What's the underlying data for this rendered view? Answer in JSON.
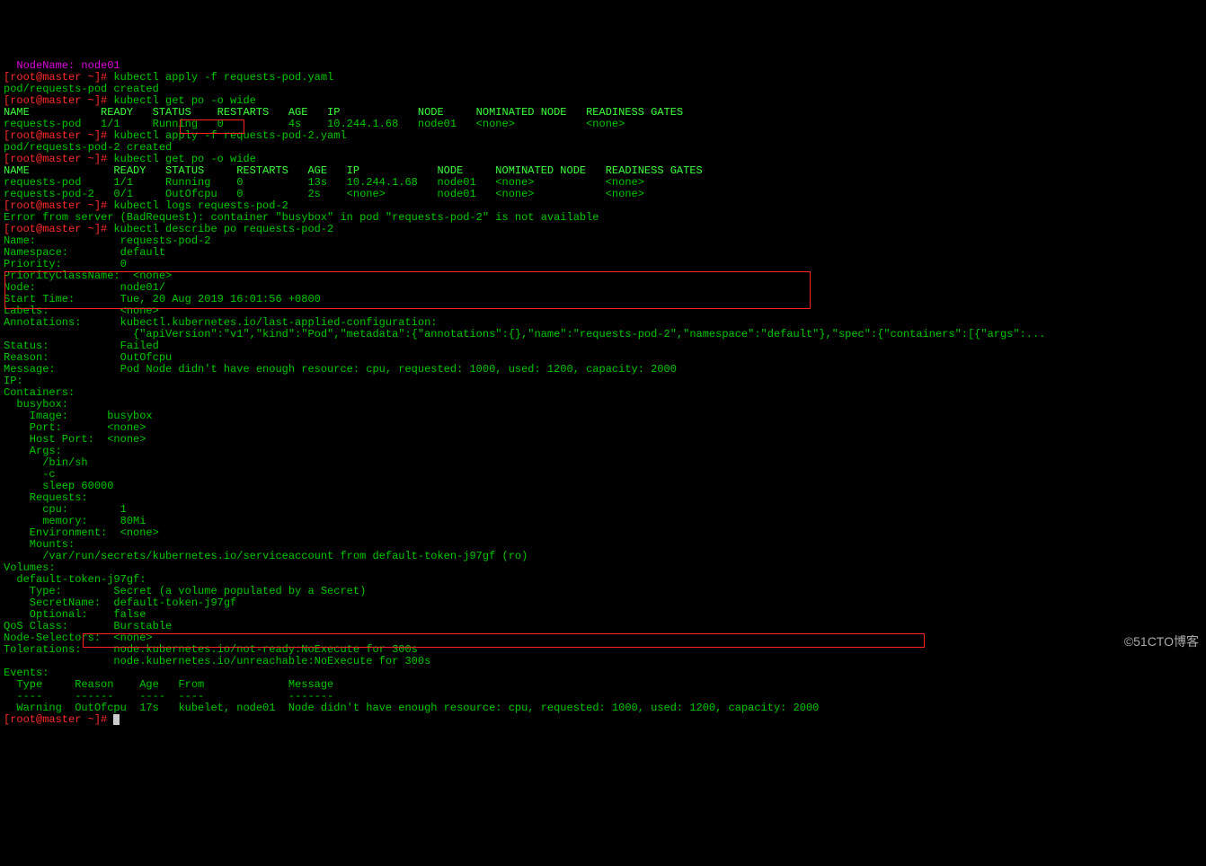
{
  "lines": {
    "l0_prompt": "[root@master ~]#",
    "l0_cmd": " kubectl apply -f requests-pod.yaml",
    "l1": "pod/requests-pod created",
    "l2_prompt": "[root@master ~]#",
    "l2_cmd": " kubectl get po -o wide",
    "hdr1": "NAME           READY   STATUS    RESTARTS   AGE   IP            NODE     NOMINATED NODE   READINESS GATES",
    "row1": "requests-pod   1/1     Running   0          4s    10.244.1.68   node01   <none>           <none>",
    "l5_prompt": "[root@master ~]#",
    "l5_cmd": " kubectl apply -f requests-pod-2.yaml",
    "l6": "pod/requests-pod-2 created",
    "l7_prompt": "[root@master ~]#",
    "l7_cmd": " kubectl get po -o wide",
    "hdr2": "NAME             READY   STATUS     RESTARTS   AGE   IP            NODE     NOMINATED NODE   READINESS GATES",
    "row2a": "requests-pod     1/1     Running    0          13s   10.244.1.68   node01   <none>           <none>",
    "row2b_a": "requests-pod-2   0/1     ",
    "row2b_b": "OutOfcpu",
    "row2b_c": "   0          2s    <none>        node01   <none>           <none>",
    "l11_prompt": "[root@master ~]#",
    "l11_cmd": " kubectl logs requests-pod-2",
    "err": "Error from server (BadRequest): container \"busybox\" in pod \"requests-pod-2\" is not available",
    "l13_prompt": "[root@master ~]#",
    "l13_cmd": " kubectl describe po requests-pod-2",
    "d_name": "Name:             requests-pod-2",
    "d_ns": "Namespace:        default",
    "d_pri": "Priority:         0",
    "d_pricls": "PriorityClassName:  <none>",
    "d_node": "Node:             node01/",
    "d_start": "Start Time:       Tue, 20 Aug 2019 16:01:56 +0800",
    "d_labels": "Labels:           <none>",
    "d_ann1": "Annotations:      kubectl.kubernetes.io/last-applied-configuration:",
    "d_ann2": "                    {\"apiVersion\":\"v1\",\"kind\":\"Pod\",\"metadata\":{\"annotations\":{},\"name\":\"requests-pod-2\",\"namespace\":\"default\"},\"spec\":{\"containers\":[{\"args\":...",
    "d_status": "Status:           Failed",
    "d_reason": "Reason:           OutOfcpu",
    "d_msg": "Message:          Pod Node didn't have enough resource: cpu, requested: 1000, used: 1200, capacity: 2000",
    "d_ip": "IP:               ",
    "d_cont": "Containers:",
    "d_busy": "  busybox:",
    "d_image": "    Image:      busybox",
    "d_port": "    Port:       <none>",
    "d_hport": "    Host Port:  <none>",
    "d_args": "    Args:",
    "d_arg1": "      /bin/sh",
    "d_arg2": "      -c",
    "d_arg3": "      sleep 60000",
    "d_req": "    Requests:",
    "d_cpu": "      cpu:        1",
    "d_mem": "      memory:     80Mi",
    "d_env": "    Environment:  <none>",
    "d_mounts": "    Mounts:",
    "d_mount1": "      /var/run/secrets/kubernetes.io/serviceaccount from default-token-j97gf (ro)",
    "d_vols": "Volumes:",
    "d_tok": "  default-token-j97gf:",
    "d_type": "    Type:        Secret (a volume populated by a Secret)",
    "d_sname": "    SecretName:  default-token-j97gf",
    "d_opt": "    Optional:    false",
    "d_qos": "QoS Class:       Burstable",
    "d_nodesel": "Node-Selectors:  <none>",
    "d_tol1": "Tolerations:     node.kubernetes.io/not-ready:NoExecute for 300s",
    "d_tol2": "                 node.kubernetes.io/unreachable:NoExecute for 300s",
    "d_events": "Events:",
    "d_evhdr": "  Type     Reason    Age   From             Message",
    "d_evsep": "  ----     ------    ----  ----             -------",
    "d_ev_a": "  Warning  ",
    "d_ev_b": "OutOfcpu  17s   kubelet, node01  Node didn't have enough resource: cpu, requested: 1000, used: 1200, capacity: 2000",
    "final_prompt": "[root@master ~]#"
  },
  "watermark": "©51CTO博客"
}
